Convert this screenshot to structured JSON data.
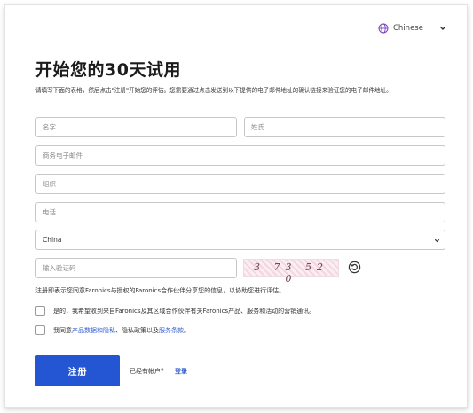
{
  "language": {
    "selected": "Chinese",
    "icon": "globe-icon"
  },
  "form": {
    "title": "开始您的30天试用",
    "description": "请填写下面的表格，然后点击\"注册\"开始您的评估。您需要通过点击发送到以下提供的电子邮件地址的确认链接来验证您的电子邮件地址。",
    "first_name_placeholder": "名字",
    "last_name_placeholder": "姓氏",
    "email_placeholder": "商务电子邮件",
    "org_placeholder": "组织",
    "phone_placeholder": "电话",
    "country_value": "China",
    "captcha_placeholder": "输入验证码",
    "captcha_code": "3 73 52 0",
    "consent_text": "注册即表示您同意Faronics与授权的Faronics合作伙伴分享您的信息，以协助您进行评估。",
    "marketing_opt_in": "是的，我希望收到来自Faronics及其区域合作伙伴有关Faronics产品、服务和活动的营销通讯。",
    "agree_prefix": "我同意",
    "agree_link_privacy": "产品数据和隐私",
    "agree_middle": "、隐私政策以及",
    "agree_link_terms": "服务条款",
    "agree_suffix": "。",
    "submit_label": "注册",
    "have_account": "已经有帐户？",
    "login_link": "登录"
  },
  "colors": {
    "primary": "#2456d4",
    "link": "#2f5bd1",
    "globe": "#7b3fbf"
  }
}
